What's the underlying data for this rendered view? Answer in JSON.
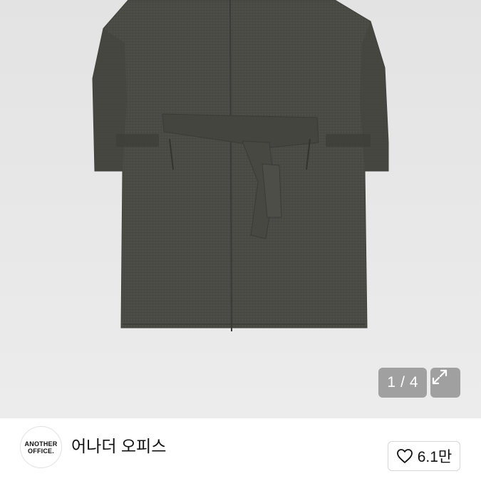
{
  "gallery": {
    "current_index": "1",
    "separator": "/",
    "total": "4",
    "expand_icon": "expand-icon"
  },
  "shop": {
    "logo_line1": "ANOTHER",
    "logo_line2": "OFFICE.",
    "name": "어나더 오피스"
  },
  "like": {
    "icon": "heart-icon",
    "count": "6.1만"
  },
  "colors": {
    "coat": "#4a4a45",
    "background": "#e6e6e6",
    "overlay": "#787878"
  }
}
